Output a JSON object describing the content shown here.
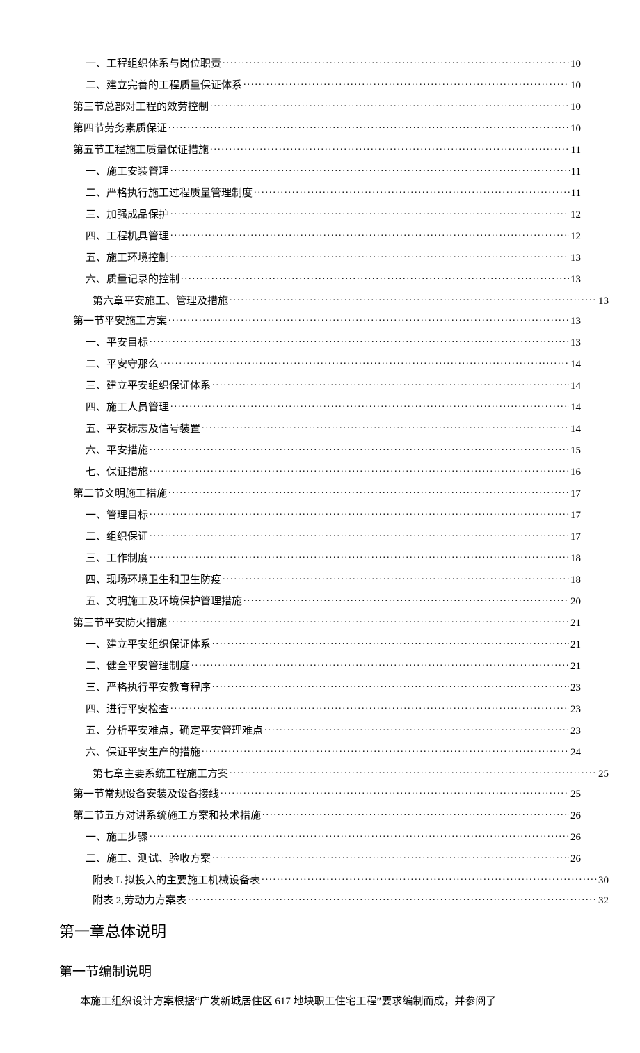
{
  "toc": [
    {
      "indent": "indent-2",
      "label": "一、工程组织体系与岗位职责",
      "page": "10",
      "wide": false
    },
    {
      "indent": "indent-2",
      "label": "二、建立完善的工程质量保证体系",
      "page": "10",
      "wide": false
    },
    {
      "indent": "indent-1",
      "label": "第三节总部对工程的效劳控制",
      "page": "10",
      "wide": false
    },
    {
      "indent": "indent-1",
      "label": "第四节劳务素质保证",
      "page": "10",
      "wide": false
    },
    {
      "indent": "indent-1",
      "label": "第五节工程施工质量保证措施",
      "page": "11",
      "wide": false
    },
    {
      "indent": "indent-2",
      "label": "一、施工安装管理",
      "page": "11",
      "wide": false
    },
    {
      "indent": "indent-2",
      "label": "二、严格执行施工过程质量管理制度",
      "page": "11",
      "wide": false
    },
    {
      "indent": "indent-2",
      "label": "三、加强成品保护",
      "page": "12",
      "wide": false
    },
    {
      "indent": "indent-2",
      "label": "四、工程机具管理",
      "page": "12",
      "wide": false
    },
    {
      "indent": "indent-2",
      "label": "五、施工环境控制",
      "page": "13",
      "wide": false
    },
    {
      "indent": "indent-2",
      "label": "六、质量记录的控制",
      "page": "13",
      "wide": false
    },
    {
      "indent": "indent-ch",
      "label": "第六章平安施工、管理及措施",
      "page": "13",
      "wide": true,
      "extra": true
    },
    {
      "indent": "indent-1",
      "label": "第一节平安施工方案",
      "page": "13",
      "wide": false
    },
    {
      "indent": "indent-2",
      "label": "一、平安目标",
      "page": "13",
      "wide": false
    },
    {
      "indent": "indent-2",
      "label": "二、平安守那么",
      "page": "14",
      "wide": false
    },
    {
      "indent": "indent-2",
      "label": "三、建立平安组织保证体系",
      "page": "14",
      "wide": false
    },
    {
      "indent": "indent-2",
      "label": "四、施工人员管理",
      "page": "14",
      "wide": false
    },
    {
      "indent": "indent-2",
      "label": "五、平安标志及信号装置",
      "page": "14",
      "wide": false
    },
    {
      "indent": "indent-2",
      "label": "六、平安措施",
      "page": "15",
      "wide": false
    },
    {
      "indent": "indent-2",
      "label": "七、保证措施",
      "page": "16",
      "wide": false
    },
    {
      "indent": "indent-1",
      "label": "第二节文明施工措施",
      "page": "17",
      "wide": false
    },
    {
      "indent": "indent-2",
      "label": "一、管理目标",
      "page": "17",
      "wide": false
    },
    {
      "indent": "indent-2",
      "label": "二、组织保证",
      "page": "17",
      "wide": false
    },
    {
      "indent": "indent-2",
      "label": "三、工作制度",
      "page": "18",
      "wide": false
    },
    {
      "indent": "indent-2",
      "label": "四、现场环境卫生和卫生防疫",
      "page": "18",
      "wide": false
    },
    {
      "indent": "indent-2",
      "label": "五、文明施工及环境保护管理措施",
      "page": "20",
      "wide": false
    },
    {
      "indent": "indent-1",
      "label": "第三节平安防火措施",
      "page": "21",
      "wide": false
    },
    {
      "indent": "indent-2",
      "label": "一、建立平安组织保证体系",
      "page": "21",
      "wide": false
    },
    {
      "indent": "indent-2",
      "label": "二、健全平安管理制度",
      "page": "21",
      "wide": false
    },
    {
      "indent": "indent-2",
      "label": "三、严格执行平安教育程序",
      "page": "23",
      "wide": false
    },
    {
      "indent": "indent-2",
      "label": "四、进行平安检查",
      "page": "23",
      "wide": false
    },
    {
      "indent": "indent-2",
      "label": "五、分析平安难点，确定平安管理难点",
      "page": "23",
      "wide": false
    },
    {
      "indent": "indent-2",
      "label": "六、保证平安生产的措施",
      "page": "24",
      "wide": false
    },
    {
      "indent": "indent-ch",
      "label": "第七章主要系统工程施工方案",
      "page": "25",
      "wide": true,
      "extra": true
    },
    {
      "indent": "indent-1",
      "label": "第一节常规设备安装及设备接线",
      "page": "25",
      "wide": false
    },
    {
      "indent": "indent-1",
      "label": "第二节五方对讲系统施工方案和技术措施",
      "page": "26",
      "wide": false
    },
    {
      "indent": "indent-2",
      "label": "一、施工步骤",
      "page": "26",
      "wide": false
    },
    {
      "indent": "indent-2",
      "label": "二、施工、测试、验收方案",
      "page": "26",
      "wide": false
    },
    {
      "indent": "indent-ch",
      "label": "附表 L 拟投入的主要施工机械设备表",
      "page": "30",
      "wide": true,
      "extra": true
    },
    {
      "indent": "indent-ch",
      "label": "附表 2,劳动力方案表",
      "page": "32",
      "wide": true,
      "extra": true
    }
  ],
  "headings": {
    "chapter1": "第一章总体说明",
    "section1": "第一节编制说明"
  },
  "body": {
    "para1": "本施工组织设计方案根据“广发新城居住区 617 地块职工住宅工程”要求编制而成，并参阅了"
  }
}
